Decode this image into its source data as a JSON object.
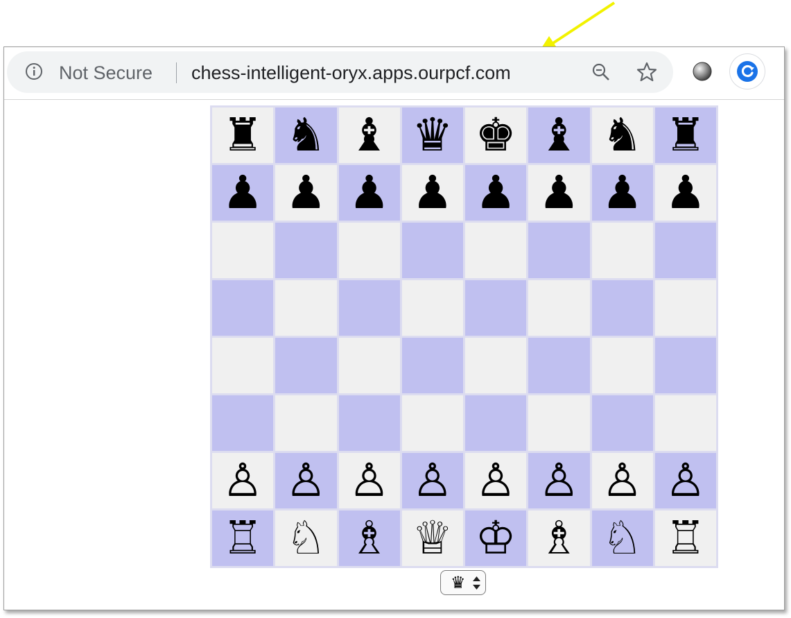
{
  "browser": {
    "security_label": "Not Secure",
    "url": "chess-intelligent-oryx.apps.ourpcf.com",
    "icons": [
      "info-icon",
      "zoom-out-icon",
      "star-icon",
      "extension-icon",
      "profile-icon"
    ],
    "accent_color": "#1a73e8"
  },
  "annotation": {
    "arrow_color": "#f2f200"
  },
  "board": {
    "light_square_color": "#f0f0f0",
    "dark_square_color": "#c0c0f0",
    "rows": [
      [
        "♜",
        "♞",
        "♝",
        "♛",
        "♚",
        "♝",
        "♞",
        "♜"
      ],
      [
        "♟",
        "♟",
        "♟",
        "♟",
        "♟",
        "♟",
        "♟",
        "♟"
      ],
      [
        "",
        "",
        "",
        "",
        "",
        "",
        "",
        ""
      ],
      [
        "",
        "",
        "",
        "",
        "",
        "",
        "",
        ""
      ],
      [
        "",
        "",
        "",
        "",
        "",
        "",
        "",
        ""
      ],
      [
        "",
        "",
        "",
        "",
        "",
        "",
        "",
        ""
      ],
      [
        "♙",
        "♙",
        "♙",
        "♙",
        "♙",
        "♙",
        "♙",
        "♙"
      ],
      [
        "♖",
        "♘",
        "♗",
        "♕",
        "♔",
        "♗",
        "♘",
        "♖"
      ]
    ]
  },
  "promotion_select": {
    "selected": "♛"
  }
}
